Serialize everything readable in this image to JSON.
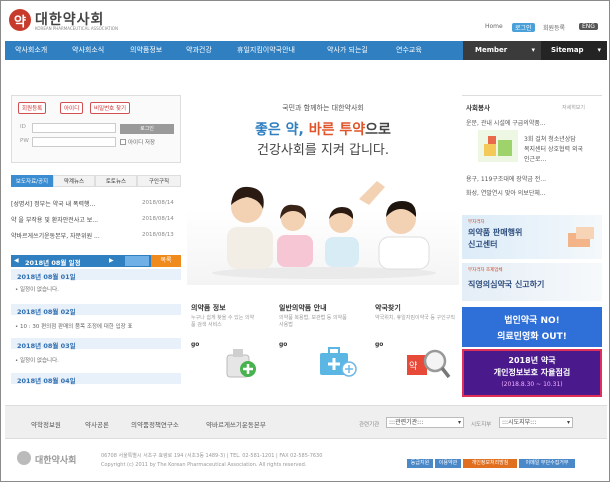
{
  "header": {
    "logo_mark": "약",
    "logo_ko": "대한약사회",
    "logo_en": "KOREAN PHARMACEUTICAL ASSOCIATION",
    "util_links": [
      "Home",
      "로그인",
      "회원등록",
      "ENG"
    ]
  },
  "nav": {
    "items": [
      "약사회소개",
      "약사회소식",
      "의약품정보",
      "약과건강",
      "휴일지킴이약국안내",
      "약사가 되는길",
      "연수교육"
    ],
    "member": "Member",
    "sitemap": "Sitemap"
  },
  "login": {
    "buttons": [
      "회원등록",
      "아이디",
      "비밀번호 찾기"
    ],
    "id_label": "ID",
    "pw_label": "PW",
    "login_button": "로그인",
    "save_id": "아이디 저장"
  },
  "news": {
    "tabs": [
      "보도자료/공지",
      "약계뉴스",
      "토토뉴스",
      "구인구직"
    ],
    "items": [
      {
        "title": "[성명서] 정부는 약국 내 폭력행...",
        "date": "2018/08/14"
      },
      {
        "title": "약 을 부작용 및 환자안전사고 보...",
        "date": "2018/08/14"
      },
      {
        "title": "약바르게쓰기운동본부, 자문위원 ...",
        "date": "2018/08/13"
      }
    ]
  },
  "calendar": {
    "header": "2018년 08월 일정",
    "more": "목록",
    "entries": [
      {
        "date": "2018년 08월 01일",
        "item": "• 일정이 없습니다."
      },
      {
        "date": "2018년 08월 02일",
        "item": "• 10 : 30 편의점 판매의 품목 조정에 대한 입장 표"
      },
      {
        "date": "2018년 08월 03일",
        "item": "• 일정이 없습니다."
      },
      {
        "date": "2018년 08월 04일",
        "item": ""
      }
    ]
  },
  "hero": {
    "eyebrow": "국민과 함께하는 대한약사회",
    "headline_a": "좋은 약,",
    "headline_b": "바른 투약",
    "headline_c": "으로",
    "subline": "건강사회를 지켜 갑니다."
  },
  "tiles": [
    {
      "title": "의약품 정보",
      "desc": "누구나 쉽게 찾을 수 있는 의약품 검색 서비스",
      "go": "go"
    },
    {
      "title": "일반의약품 안내",
      "desc": "의약품 복용법, 보관법 등 의약품 사용법",
      "go": "go"
    },
    {
      "title": "약국찾기",
      "desc": "약국위치, 휴일지킴이약국 등 구인구직",
      "go": "go"
    }
  ],
  "right": {
    "title": "사회봉사",
    "more": "자세히보기",
    "story1": "운문, 관내 시설에 구급의약품...",
    "story2_lines": [
      "3회 걸쳐 청소년상담",
      "복지센터 상호협력 외국",
      "인근로..."
    ],
    "story3": "용구, 119구조대에 장약금 전...",
    "story4": "화성, 연말연시 맞아 의보단체...",
    "banner1_eyebrow": "무자격자",
    "banner1_lines": [
      "의약품 판매행위",
      "신고센터"
    ],
    "banner2_eyebrow": "무자격자 조제업체",
    "banner2_line": "직영의심약국 신고하기",
    "banner3_lines": [
      "법인약국 NO!",
      "의료민영화 OUT!"
    ],
    "banner4_lines": [
      "2018년 약국",
      "개인정보보호 자율점검"
    ],
    "banner4_period": "(2018.8.30 ~ 10.31)"
  },
  "footer": {
    "links": [
      "약학정보원",
      "약사공론",
      "의약품정책연구소",
      "약바르게쓰기운동본부"
    ],
    "related_label": "관련기관",
    "related_value": ":::관련기관:::",
    "branch_label": "시도지부",
    "branch_value": ":::시도지부:::",
    "logo": "대한약사회",
    "address": "06708 서울특별시 서초구 효령로 194 (서초3동 1489-3)   |   TEL. 02-581-1201   |   FAX 02-585-7630",
    "copyright": "Copyright (c) 2011 by The Korean Pharmaceutical Association. All rights reserved.",
    "buttons": [
      "등급지원",
      "이용약관",
      "개인정보처리방침",
      "이메일 무단수집거부"
    ]
  },
  "colors": {
    "brand": "#2f7fc1",
    "accent": "#c73b2c",
    "banner_purple": "#4a1a8c"
  }
}
